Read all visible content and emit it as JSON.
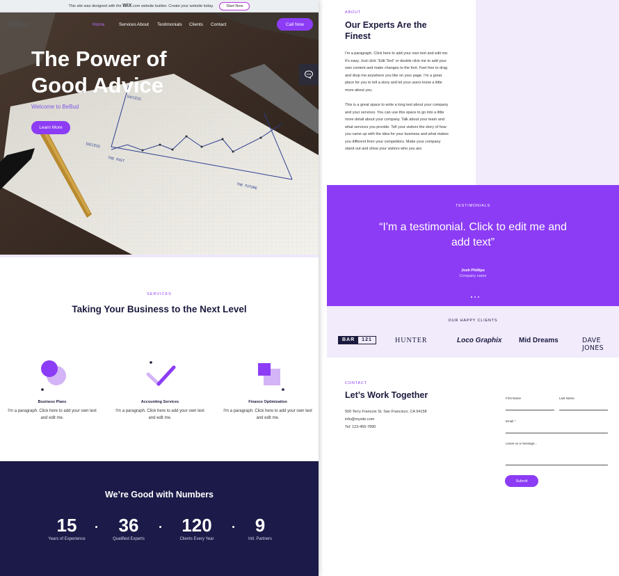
{
  "colors": {
    "accent": "#8c3cf5",
    "accent_light": "#f1ebfc",
    "navy": "#1b1a48",
    "heading": "#1b1a3e"
  },
  "wix_banner": {
    "text_before": "This site was designed with the",
    "brand": "WiX",
    "text_after": ".com website builder. Create your website today.",
    "button": "Start Now"
  },
  "nav": {
    "logo": "BeBud",
    "items": [
      "Home",
      "Services",
      "About",
      "Testimonials",
      "Clients",
      "Contact"
    ],
    "call_button": "Call Now"
  },
  "hero": {
    "title": "The Power of Good Advice",
    "subtitle": "Welcome to BeBud",
    "button": "Learn More",
    "chart_labels": {
      "y": "SUCCESS",
      "x_left": "SUCCESS",
      "past": "THE PAST",
      "future": "THE FUTURE"
    }
  },
  "chat": {
    "icon": "chat-bubble-icon"
  },
  "services": {
    "eyebrow": "SERVICES",
    "title": "Taking Your Business to the Next Level",
    "items": [
      {
        "icon": "overlapping-circles-icon",
        "name": "Business Plans",
        "desc": "I'm a paragraph. Click here to add your own text and edit me."
      },
      {
        "icon": "checkmark-icon",
        "name": "Accounting Services",
        "desc": "I'm a paragraph. Click here to add your own text and edit me."
      },
      {
        "icon": "overlapping-squares-icon",
        "name": "Finance Optimization",
        "desc": "I'm a paragraph. Click here to add your own text and edit me."
      }
    ]
  },
  "numbers": {
    "title": "We’re Good with Numbers",
    "stats": [
      {
        "value": "15",
        "label": "Years of Experience"
      },
      {
        "value": "36",
        "label": "Qualified Experts"
      },
      {
        "value": "120",
        "label": "Clients Every Year"
      },
      {
        "value": "9",
        "label": "Intl. Partners"
      }
    ]
  },
  "about": {
    "eyebrow": "ABOUT",
    "title": "Our Experts Are the Finest",
    "p1": "I'm a paragraph. Click here to add your own text and edit me. It's easy. Just click “Edit Text” or double click me to add your own content and make changes to the font. Feel free to drag and drop me anywhere you like on your page. I’m a great place for you to tell a story and let your users know a little more about you.",
    "p2": "This is a great space to write a long text about your company and your services. You can use this space to go into a little more detail about your company. Talk about your team and what services you provide. Tell your visitors the story of how you came up with the idea for your business and what makes you different from your competitors. Make your company stand out and show your visitors who you are."
  },
  "testimonials": {
    "eyebrow": "TESTIMONIALS",
    "quote": "“I'm a testimonial. Click to edit me and add text”",
    "name": "Josh Phillips",
    "company": "Company name"
  },
  "clients": {
    "eyebrow": "OUR HAPPY CLIENTS",
    "logos": [
      {
        "part1": "BAR",
        "part2": "121"
      },
      {
        "name": "HUNTER"
      },
      {
        "name": "Loco Graphix"
      },
      {
        "name": "Mid Dreams"
      },
      {
        "name": "DAVE JONES"
      }
    ]
  },
  "contact": {
    "eyebrow": "CONTACT",
    "title": "Let’s Work Together",
    "address": "500 Terry Francois St. San Francisco, CA 94158",
    "email": "info@mysite.com",
    "phone": "Tel: 123-456-7890",
    "form": {
      "first_name": "First Name",
      "last_name": "Last Name",
      "email": "Email *",
      "message": "Leave us a message...",
      "submit": "Submit"
    }
  }
}
